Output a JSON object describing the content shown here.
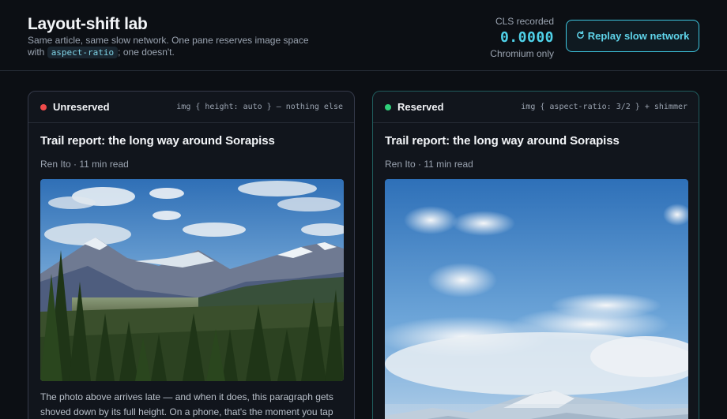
{
  "header": {
    "title": "Layout-shift lab",
    "subtitle_pre": "Same article, same slow network. One pane reserves image space with",
    "subtitle_code": "aspect-ratio",
    "subtitle_post": "; one doesn't.",
    "cls_label": "CLS recorded",
    "cls_value": "0.0000",
    "cls_note": "Chromium only",
    "replay_label": "Replay slow network",
    "replay_icon": "refresh-icon"
  },
  "panes": [
    {
      "label": "Unreserved",
      "status_color": "#ef4b4b",
      "rule": "img { height: auto } — nothing else",
      "article_title": "Trail report: the long way around Sorapiss",
      "meta": "Ren Ito · 11 min read",
      "body": "The photo above arrives late — and when it does, this paragraph gets shoved down by its full height. On a phone, that's the moment you tap"
    },
    {
      "label": "Reserved",
      "status_color": "#2fd07a",
      "rule": "img { aspect-ratio: 3/2 } + shimmer",
      "article_title": "Trail report: the long way around Sorapiss",
      "meta": "Ren Ito · 11 min read"
    }
  ],
  "colors": {
    "accent": "#3ec6e0",
    "background": "#0c0f14"
  }
}
